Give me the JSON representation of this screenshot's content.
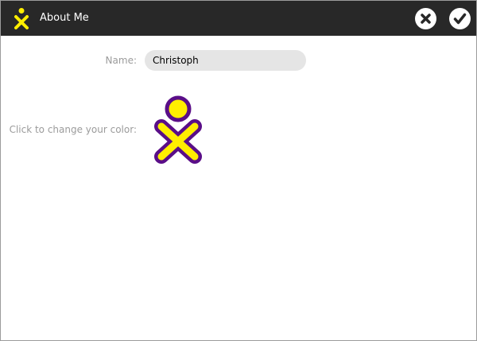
{
  "window": {
    "title": "About Me"
  },
  "toolbar": {
    "cancel_icon": "cancel-icon",
    "ok_icon": "ok-icon",
    "logo_icon": "xo-icon"
  },
  "form": {
    "name_label": "Name:",
    "name_value": "Christoph",
    "color_label": "Click to change your color:"
  },
  "colors": {
    "toolbar_bg": "#282828",
    "xo_stroke": "#5a0e88",
    "xo_fill": "#ffee00",
    "entry_bg": "#e5e5e5",
    "label_text": "#9b9b9b"
  }
}
